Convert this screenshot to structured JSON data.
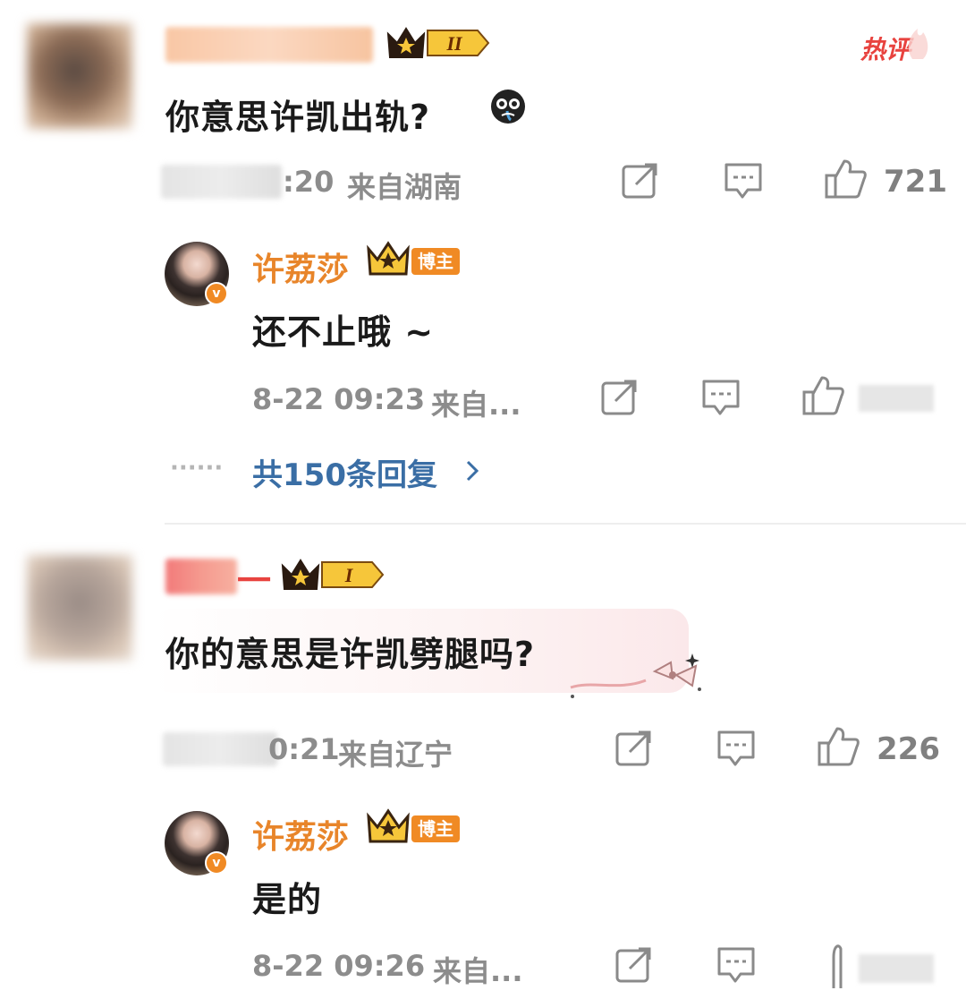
{
  "comments": [
    {
      "text": "你意思许凯出轨?",
      "emoji": "crying-face-emoji",
      "time": ":20",
      "location": "来自湖南",
      "likes": "721",
      "hot_badge": "热评",
      "level_badge": "II",
      "reply": {
        "author": "许荔莎",
        "tag": "博主",
        "text": "还不止哦 ~",
        "time": "8-22 09:23",
        "location": "来自..."
      },
      "replies_link": "共150条回复",
      "replies_dots": "······"
    },
    {
      "author_partial": "一",
      "text": "你的意思是许凯劈腿吗?",
      "time": "0:21",
      "location": "来自辽宁",
      "likes": "226",
      "level_badge": "I",
      "reply": {
        "author": "许荔莎",
        "tag": "博主",
        "text": "是的",
        "time": "8-22 09:26",
        "location": "来自..."
      }
    }
  ],
  "colors": {
    "blogger_name": "#e8852a",
    "reply_link": "#3a6ea5",
    "hot": "#e8433f",
    "meta": "#8c8c8c"
  }
}
